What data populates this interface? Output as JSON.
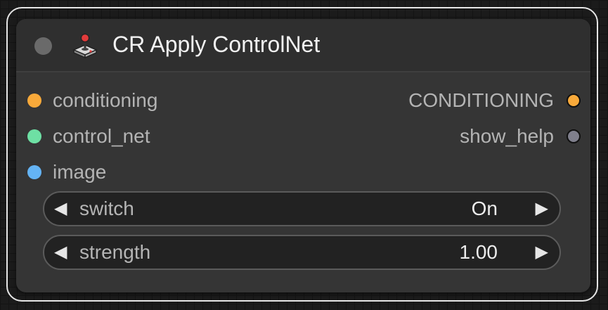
{
  "node": {
    "title": "CR Apply ControlNet",
    "title_icon": "joystick-icon",
    "inputs": [
      {
        "label": "conditioning",
        "color": "#f8a93a"
      },
      {
        "label": "control_net",
        "color": "#6ee0a4"
      },
      {
        "label": "image",
        "color": "#64b3f4"
      }
    ],
    "outputs": [
      {
        "label": "CONDITIONING",
        "color": "#f8a93a"
      },
      {
        "label": "show_help",
        "color": "#7f7f8c"
      }
    ],
    "widgets": [
      {
        "name": "switch",
        "value": "On",
        "left_arrow": "◀",
        "right_arrow": "▶"
      },
      {
        "name": "strength",
        "value": "1.00",
        "left_arrow": "◀",
        "right_arrow": "▶"
      }
    ]
  }
}
